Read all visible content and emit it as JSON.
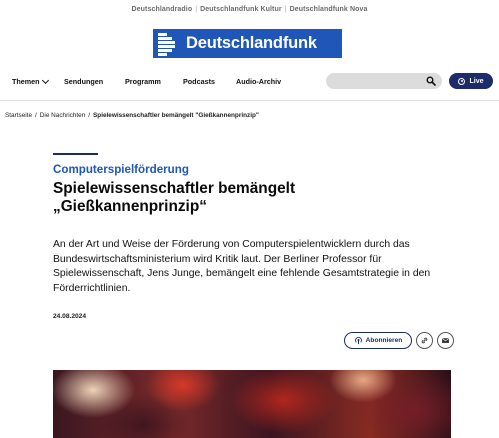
{
  "network": {
    "links": [
      "Deutschlandradio",
      "Deutschlandfunk Kultur",
      "Deutschlandfunk Nova"
    ],
    "separator": "|"
  },
  "logo": {
    "text": "Deutschlandfunk",
    "icon": "dlf-logo-mark"
  },
  "nav": {
    "items": [
      "Themen",
      "Sendungen",
      "Programm",
      "Podcasts",
      "Audio-Archiv"
    ],
    "search_icon": "search-icon",
    "live_label": "Live",
    "live_icon": "live-radio-icon"
  },
  "breadcrumb": {
    "items": [
      "Startseite",
      "Die Nachrichten",
      "Spielewissenschaftler bemängelt \"Gießkannenprinzip\""
    ],
    "separator": "/"
  },
  "article": {
    "kicker": "Computerspielförderung",
    "headline": "Spielewissenschaftler bemängelt „Gießkannenprinzip“",
    "lead": "An der Art und Weise der Förderung von Computerspielentwicklern durch das Bundeswirtschaftsministerium wird Kritik laut. Der Berliner Professor für Spielewissenschaft, Jens Junge, bemängelt eine fehlende Gesamtstrategie in den Förderrichtlinien.",
    "date": "24.08.2024"
  },
  "actions": {
    "subscribe_label": "Abonnieren",
    "subscribe_icon": "podcast-icon",
    "link_icon": "link-icon",
    "mail_icon": "mail-icon"
  },
  "colors": {
    "brand": "#1f56b8",
    "navy": "#1c2c6b"
  }
}
